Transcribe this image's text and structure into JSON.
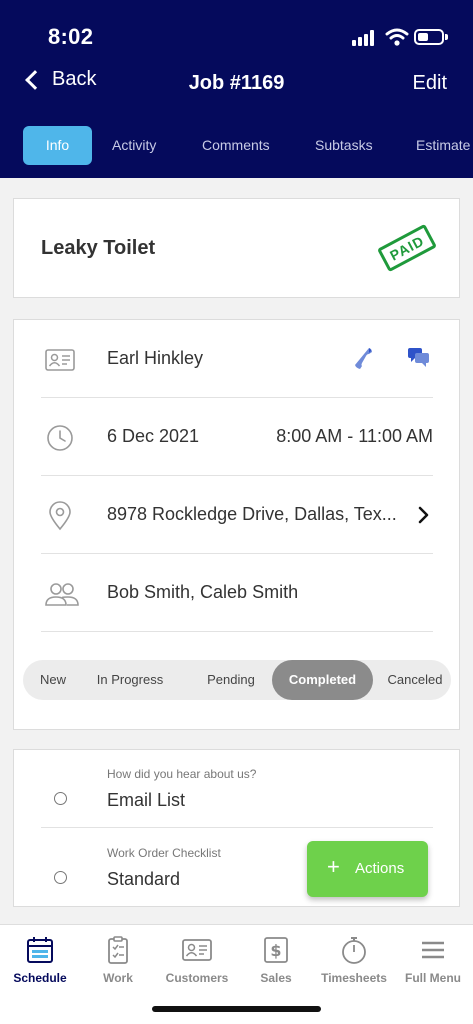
{
  "status_bar": {
    "time": "8:02"
  },
  "nav": {
    "back_label": "Back",
    "title": "Job #1169",
    "edit_label": "Edit"
  },
  "tabs": [
    {
      "label": "Info",
      "active": true
    },
    {
      "label": "Activity",
      "active": false
    },
    {
      "label": "Comments",
      "active": false
    },
    {
      "label": "Subtasks",
      "active": false
    },
    {
      "label": "Estimate",
      "active": false
    }
  ],
  "job": {
    "title": "Leaky Toilet",
    "stamp": "PAID",
    "stamp_color": "#1f9a3b"
  },
  "details": {
    "customer_name": "Earl Hinkley",
    "date": "6 Dec 2021",
    "time_range": "8:00 AM - 11:00 AM",
    "address": "8978 Rockledge Drive, Dallas, Tex...",
    "assignees": "Bob Smith, Caleb Smith"
  },
  "status_options": {
    "items": [
      "New",
      "In Progress",
      "Pending",
      "Completed",
      "Canceled"
    ],
    "selected": "Completed"
  },
  "questions": [
    {
      "label": "How did you hear about us?",
      "value": "Email List"
    },
    {
      "label": "Work Order Checklist",
      "value": "Standard"
    }
  ],
  "fab": {
    "label": "Actions",
    "color": "#6ed14b"
  },
  "bottom_tabs": [
    {
      "label": "Schedule",
      "icon": "calendar-icon",
      "active": true
    },
    {
      "label": "Work",
      "icon": "clipboard-icon",
      "active": false
    },
    {
      "label": "Customers",
      "icon": "contact-card-icon",
      "active": false
    },
    {
      "label": "Sales",
      "icon": "dollar-icon",
      "active": false
    },
    {
      "label": "Timesheets",
      "icon": "stopwatch-icon",
      "active": false
    },
    {
      "label": "Full Menu",
      "icon": "hamburger-icon",
      "active": false
    }
  ],
  "colors": {
    "header": "#050a5c",
    "tab_active": "#4fb6ea",
    "accent_blue": "#1f4fc9"
  }
}
